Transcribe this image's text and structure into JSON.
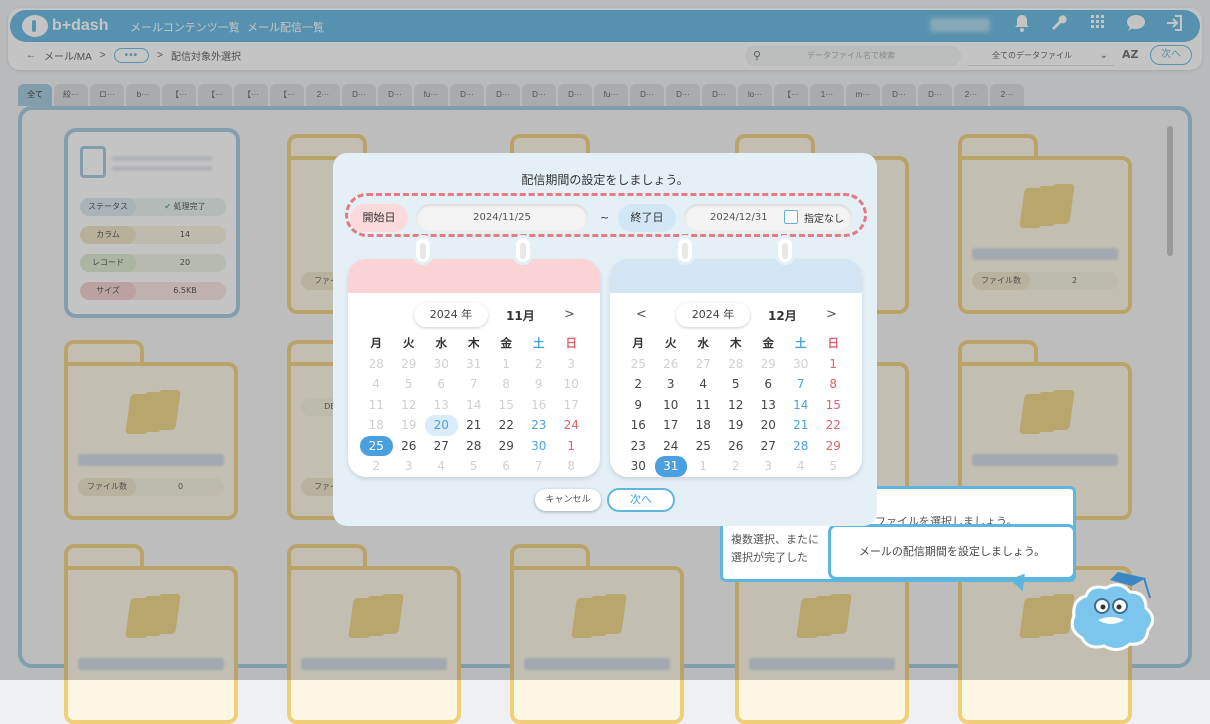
{
  "header": {
    "logo": "b+dash",
    "nav": [
      "メールコンテンツ一覧",
      "メール配信一覧"
    ],
    "icons": [
      "bell-icon",
      "wrench-icon",
      "grid-icon",
      "chat-icon",
      "logout-icon"
    ]
  },
  "breadcrumb": {
    "back": "←",
    "first": "メール/MA",
    "sep1": ">",
    "dots": "•••",
    "sep2": ">",
    "current": "配信対象外選択"
  },
  "toolbar": {
    "search_placeholder": "データファイル名で検索",
    "filter_value": "全てのデータファイル",
    "sort_label": "AZ",
    "next_label": "次へ"
  },
  "tabs": [
    "全て",
    "絞···",
    "ロ···",
    "b···",
    "【···",
    "【···",
    "【···",
    "【···",
    "2···",
    "D···",
    "D···",
    "fu···",
    "D···",
    "D···",
    "D···",
    "D···",
    "fu···",
    "D···",
    "D···",
    "D···",
    "lo···",
    "【···",
    "1···",
    "m···",
    "D···",
    "D···",
    "2···",
    "2···"
  ],
  "csv_card": {
    "rows": [
      {
        "label": "ステータス",
        "value": "処理完了"
      },
      {
        "label": "カラム",
        "value": "14"
      },
      {
        "label": "レコード",
        "value": "20"
      },
      {
        "label": "サイズ",
        "value": "6.5KB"
      }
    ]
  },
  "folders": [
    {
      "count_label": "ファイル数",
      "count": "2"
    },
    {
      "count_label": "ファイル数",
      "count": "0"
    },
    {
      "count_label": "ファイル",
      "count": ""
    },
    {
      "count_label": "ファイル",
      "count": ""
    },
    {
      "count_label": "DB",
      "count": ""
    }
  ],
  "guide": {
    "line1": "ファイルを選択しましょう。",
    "line2": "複数選択、またに",
    "line3": "選択が完了した",
    "bubble": "メールの配信期間を設定しましょう。"
  },
  "modal": {
    "title": "配信期間の設定をしましょう。",
    "start_label": "開始日",
    "start_value": "2024/11/25",
    "tilde": "~",
    "end_label": "終了日",
    "end_value": "2024/12/31",
    "no_end_label": "指定なし",
    "cancel": "キャンセル",
    "next": "次へ",
    "weekdays": [
      "月",
      "火",
      "水",
      "木",
      "金",
      "土",
      "日"
    ],
    "cal_left": {
      "prev": "",
      "next": ">",
      "year": "2024 年",
      "month": "11月",
      "weeks": [
        [
          "28",
          "29",
          "30",
          "31",
          "1",
          "2",
          "3"
        ],
        [
          "4",
          "5",
          "6",
          "7",
          "8",
          "9",
          "10"
        ],
        [
          "11",
          "12",
          "13",
          "14",
          "15",
          "16",
          "17"
        ],
        [
          "18",
          "19",
          "20",
          "21",
          "22",
          "23",
          "24"
        ],
        [
          "25",
          "26",
          "27",
          "28",
          "29",
          "30",
          "1"
        ],
        [
          "2",
          "3",
          "4",
          "5",
          "6",
          "7",
          "8"
        ]
      ]
    },
    "cal_right": {
      "prev": "<",
      "next": ">",
      "year": "2024 年",
      "month": "12月",
      "weeks": [
        [
          "25",
          "26",
          "27",
          "28",
          "29",
          "30",
          "1"
        ],
        [
          "2",
          "3",
          "4",
          "5",
          "6",
          "7",
          "8"
        ],
        [
          "9",
          "10",
          "11",
          "12",
          "13",
          "14",
          "15"
        ],
        [
          "16",
          "17",
          "18",
          "19",
          "20",
          "21",
          "22"
        ],
        [
          "23",
          "24",
          "25",
          "26",
          "27",
          "28",
          "29"
        ],
        [
          "30",
          "31",
          "1",
          "2",
          "3",
          "4",
          "5"
        ]
      ]
    }
  }
}
